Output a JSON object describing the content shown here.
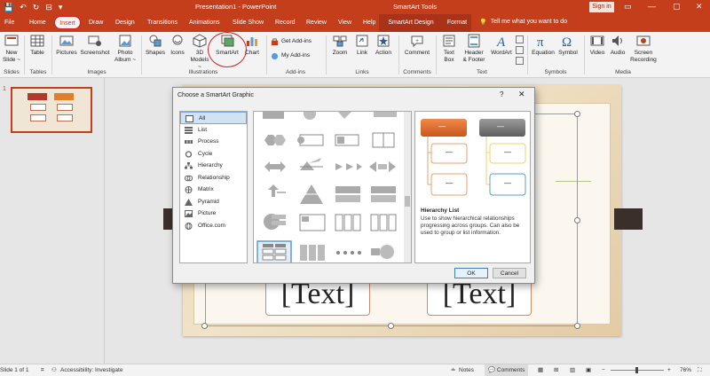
{
  "titlebar": {
    "document_title": "Presentation1 - PowerPoint",
    "context_title": "SmartArt Tools",
    "sign_in": "Sign in",
    "qat": [
      "💾",
      "↶",
      "↻",
      "⊟",
      "▾"
    ],
    "window_controls": [
      "▭",
      "—",
      "▢",
      "✕"
    ]
  },
  "tabs": {
    "file": "File",
    "home": "Home",
    "insert": "Insert",
    "draw": "Draw",
    "design": "Design",
    "transitions": "Transitions",
    "animations": "Animations",
    "slideshow": "Slide Show",
    "record": "Record",
    "review": "Review",
    "view": "View",
    "help": "Help",
    "smartart_design": "SmartArt Design",
    "format": "Format",
    "tell_me": "Tell me what you want to do"
  },
  "ribbon": {
    "new_slide": "New",
    "new_slide2": "Slide ~",
    "table": "Table",
    "pictures": "Pictures",
    "screenshot": "Screenshot",
    "photo_album": "Photo",
    "photo_album2": "Album ~",
    "shapes": "Shapes",
    "icons": "Icons",
    "models": "3D",
    "models2": "Models ~",
    "smartart": "SmartArt",
    "chart": "Chart",
    "get_addins": "Get Add-ins",
    "my_addins": "My Add-ins",
    "zoom": "Zoom",
    "link": "Link",
    "action": "Action",
    "comment": "Comment",
    "text_box": "Text",
    "text_box2": "Box",
    "header_footer": "Header",
    "header_footer2": "& Footer",
    "wordart": "WordArt",
    "equation": "Equation",
    "symbol": "Symbol",
    "video": "Video",
    "audio": "Audio",
    "screen_recording": "Screen",
    "screen_recording2": "Recording",
    "groups": {
      "slides": "Slides",
      "tables": "Tables",
      "images": "Images",
      "illustrations": "Illustrations",
      "addins": "Add-ins",
      "links": "Links",
      "comments": "Comments",
      "text": "Text",
      "symbols": "Symbols",
      "media": "Media"
    }
  },
  "thumbnails": {
    "slide_number": "1"
  },
  "slide": {
    "text_left": "[Text]",
    "text_right": "[Text]"
  },
  "dialog": {
    "title": "Choose a SmartArt Graphic",
    "help": "?",
    "close": "✕",
    "categories": [
      "All",
      "List",
      "Process",
      "Cycle",
      "Hierarchy",
      "Relationship",
      "Matrix",
      "Pyramid",
      "Picture",
      "Office.com"
    ],
    "selected_category": "All",
    "preview_name": "Hierarchy List",
    "preview_description": "Use to show hierarchical relationships progressing across groups. Can also be used to group or list information.",
    "preview_placeholder": "—",
    "ok": "OK",
    "cancel": "Cancel"
  },
  "statusbar": {
    "slide_of": "Slide 1 of 1",
    "accessibility": "Accessibility: Investigate",
    "notes": "Notes",
    "comments": "Comments",
    "zoom": "76%"
  },
  "colors": {
    "accent": "#c43e1c",
    "orange": "#e0702a",
    "gray_box": "#7a7a7a",
    "selection_blue": "#5b9bd5"
  }
}
